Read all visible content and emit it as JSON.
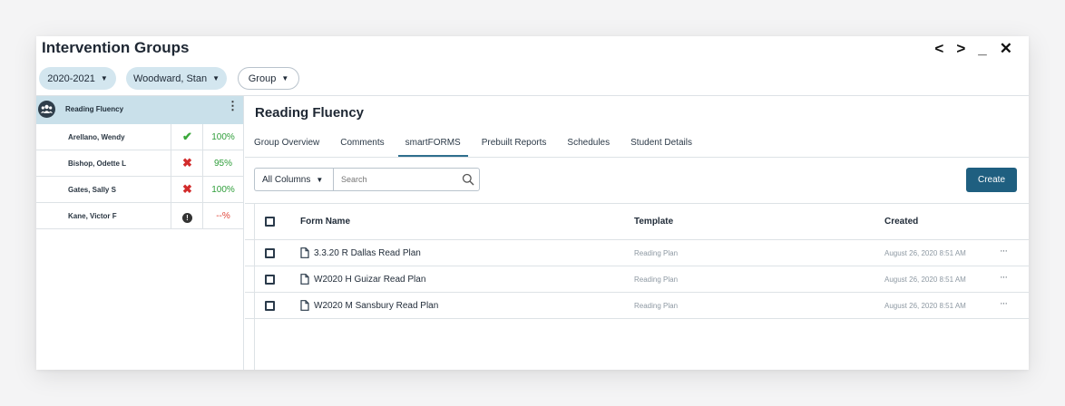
{
  "window": {
    "title": "Intervention Groups",
    "controls": {
      "prev": "<",
      "next": ">",
      "minimize": "_",
      "close": "✕"
    }
  },
  "filters": {
    "year": "2020-2021",
    "teacher": "Woodward, Stan",
    "group": "Group"
  },
  "sidebar": {
    "group_name": "Reading Fluency",
    "students": [
      {
        "name": "Arellano, Wendy",
        "status": "check",
        "percent": "100%"
      },
      {
        "name": "Bishop, Odette L",
        "status": "cross",
        "percent": "95%"
      },
      {
        "name": "Gates, Sally S",
        "status": "cross",
        "percent": "100%"
      },
      {
        "name": "Kane, Victor F",
        "status": "info",
        "percent": "--%"
      }
    ]
  },
  "main": {
    "title": "Reading Fluency",
    "tabs": [
      {
        "label": "Group Overview",
        "active": false
      },
      {
        "label": "Comments",
        "active": false
      },
      {
        "label": "smartFORMS",
        "active": true
      },
      {
        "label": "Prebuilt Reports",
        "active": false
      },
      {
        "label": "Schedules",
        "active": false
      },
      {
        "label": "Student Details",
        "active": false
      }
    ],
    "toolbar": {
      "column_select": "All Columns",
      "search_placeholder": "Search",
      "create_label": "Create"
    },
    "table": {
      "headers": {
        "form_name": "Form Name",
        "template": "Template",
        "created": "Created"
      },
      "rows": [
        {
          "form_name": "3.3.20 R Dallas Read Plan",
          "template": "Reading Plan",
          "created": "August 26, 2020 8:51 AM"
        },
        {
          "form_name": "W2020 H Guizar Read Plan",
          "template": "Reading Plan",
          "created": "August 26, 2020 8:51 AM"
        },
        {
          "form_name": "W2020 M Sansbury Read Plan",
          "template": "Reading Plan",
          "created": "August 26, 2020 8:51 AM"
        }
      ],
      "row_menu": "···"
    }
  },
  "colors": {
    "accent": "#1f5f80",
    "header_blue": "#c9e0ea",
    "pill_blue": "#d3e6ef",
    "ok_green": "#3aa83a",
    "error_red": "#d22c2c"
  }
}
